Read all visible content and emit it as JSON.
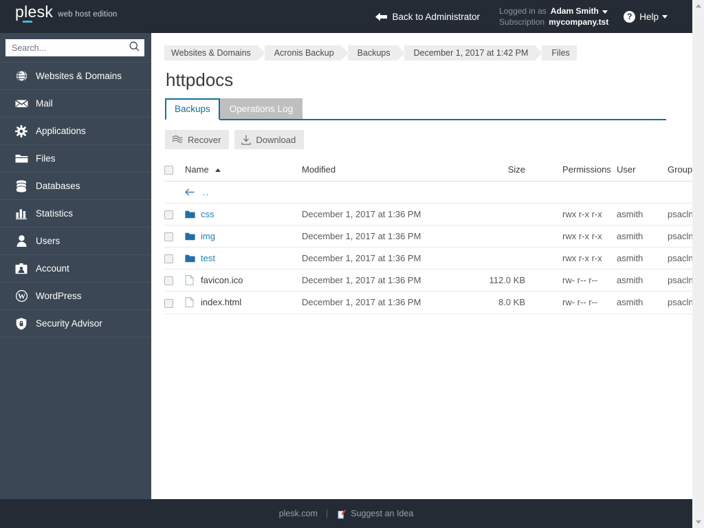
{
  "header": {
    "logo_text": "plesk",
    "logo_edition": "web host edition",
    "back_label": "Back to Administrator",
    "logged_in_label": "Logged in as",
    "logged_in_user": "Adam Smith",
    "subscription_label": "Subscription",
    "subscription_value": "mycompany.tst",
    "help_label": "Help",
    "help_glyph": "?"
  },
  "sidebar": {
    "search_placeholder": "Search...",
    "search_value": "",
    "items": [
      {
        "label": "Websites & Domains",
        "icon": "globe-icon"
      },
      {
        "label": "Mail",
        "icon": "envelope-icon"
      },
      {
        "label": "Applications",
        "icon": "gear-icon"
      },
      {
        "label": "Files",
        "icon": "folder-icon"
      },
      {
        "label": "Databases",
        "icon": "database-icon"
      },
      {
        "label": "Statistics",
        "icon": "bar-chart-icon"
      },
      {
        "label": "Users",
        "icon": "user-icon"
      },
      {
        "label": "Account",
        "icon": "id-card-icon"
      },
      {
        "label": "WordPress",
        "icon": "wordpress-icon"
      },
      {
        "label": "Security Advisor",
        "icon": "shield-lock-icon"
      }
    ]
  },
  "breadcrumb": [
    {
      "label": "Websites & Domains"
    },
    {
      "label": "Acronis Backup"
    },
    {
      "label": "Backups"
    },
    {
      "label": "December 1, 2017 at 1:42 PM"
    },
    {
      "label": "Files"
    }
  ],
  "page": {
    "title": "httpdocs"
  },
  "tabs": [
    {
      "label": "Backups",
      "active": true
    },
    {
      "label": "Operations Log",
      "active": false
    }
  ],
  "toolbar": {
    "recover_label": "Recover",
    "download_label": "Download"
  },
  "table": {
    "columns": {
      "name": "Name",
      "modified": "Modified",
      "size": "Size",
      "permissions": "Permissions",
      "user": "User",
      "group": "Group"
    },
    "sort_column": "Name",
    "sort_direction": "asc",
    "parent_row": {
      "label": ".."
    },
    "rows": [
      {
        "name": "css",
        "type": "folder",
        "modified": "December 1, 2017 at 1:36 PM",
        "size": "",
        "permissions": "rwx r-x r-x",
        "user": "asmith",
        "group": "psacln"
      },
      {
        "name": "img",
        "type": "folder",
        "modified": "December 1, 2017 at 1:36 PM",
        "size": "",
        "permissions": "rwx r-x r-x",
        "user": "asmith",
        "group": "psacln"
      },
      {
        "name": "test",
        "type": "folder",
        "modified": "December 1, 2017 at 1:36 PM",
        "size": "",
        "permissions": "rwx r-x r-x",
        "user": "asmith",
        "group": "psacln"
      },
      {
        "name": "favicon.ico",
        "type": "file",
        "modified": "December 1, 2017 at 1:36 PM",
        "size": "112.0 KB",
        "permissions": "rw- r-- r--",
        "user": "asmith",
        "group": "psacln"
      },
      {
        "name": "index.html",
        "type": "file",
        "modified": "December 1, 2017 at 1:36 PM",
        "size": "8.0 KB",
        "permissions": "rw- r-- r--",
        "user": "asmith",
        "group": "psacln"
      }
    ]
  },
  "footer": {
    "site_label": "plesk.com",
    "separator": "|",
    "idea_label": "Suggest an Idea"
  },
  "colors": {
    "header_bg": "#242b34",
    "sidebar_bg": "#3b4754",
    "accent": "#137099",
    "link": "#1a7fb5",
    "logo_accent": "#3fb7e0",
    "folder_icon": "#1f6fa8"
  }
}
